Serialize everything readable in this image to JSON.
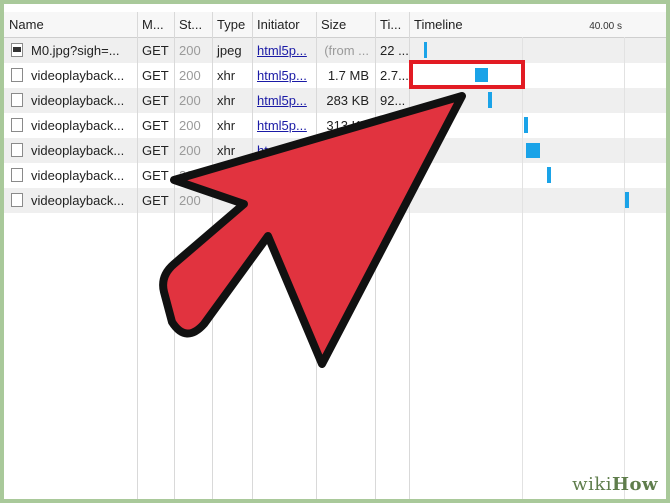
{
  "header": {
    "name": "Name",
    "method": "M...",
    "status": "St...",
    "type": "Type",
    "initiator": "Initiator",
    "size": "Size",
    "time": "Ti...",
    "timeline": "Timeline",
    "scale_label": "40.00 s"
  },
  "rows": [
    {
      "name": "M0.jpg?sigh=...",
      "method": "GET",
      "status": "200",
      "type": "jpeg",
      "initiator": "html5p...",
      "size": "(from ...",
      "time": "22 ..."
    },
    {
      "name": "videoplayback...",
      "method": "GET",
      "status": "200",
      "type": "xhr",
      "initiator": "html5p...",
      "size": "1.7 MB",
      "time": "2.7..."
    },
    {
      "name": "videoplayback...",
      "method": "GET",
      "status": "200",
      "type": "xhr",
      "initiator": "html5p...",
      "size": "283 KB",
      "time": "92..."
    },
    {
      "name": "videoplayback...",
      "method": "GET",
      "status": "200",
      "type": "xhr",
      "initiator": "html5p...",
      "size": "313 KB",
      "time": ""
    },
    {
      "name": "videoplayback...",
      "method": "GET",
      "status": "200",
      "type": "xhr",
      "initiator": "ht",
      "size": "",
      "time": ""
    },
    {
      "name": "videoplayback...",
      "method": "GET",
      "status": "20",
      "type": "",
      "initiator": "",
      "size": "",
      "time": ""
    },
    {
      "name": "videoplayback...",
      "method": "GET",
      "status": "200",
      "type": "",
      "initiator": "",
      "size": "",
      "time": ""
    }
  ],
  "colors": {
    "highlight": "#e21b23",
    "arrow": "#e1333f",
    "timeline_bar": "#1aa3e8",
    "background": "#a9c99a"
  },
  "watermark": {
    "part1": "wiki",
    "part2": "How"
  }
}
